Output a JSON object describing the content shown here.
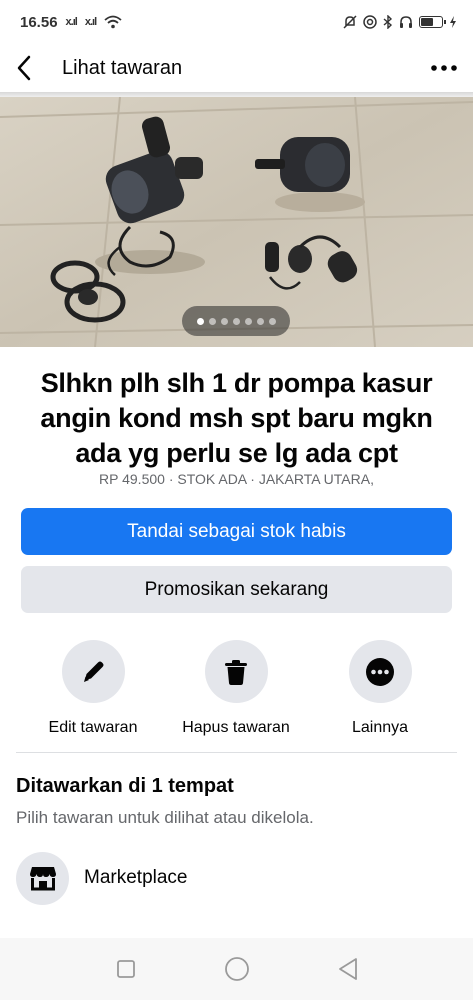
{
  "status_bar": {
    "time": "16.56",
    "signal_1": "x.ıl",
    "signal_2": "x.ıl",
    "icons": [
      "wifi-icon",
      "mute-icon",
      "at-icon",
      "bluetooth-icon",
      "headphones-icon",
      "battery-icon"
    ]
  },
  "header": {
    "title": "Lihat tawaran",
    "back_icon": "back-chevron-icon",
    "more_icon": "more-dots-icon"
  },
  "photo": {
    "page_count": 7,
    "active_index": 0
  },
  "listing": {
    "title_lines": [
      "Slhkn plh slh 1 dr pompa kasur",
      "angin kond msh spt baru mgkn",
      "ada yg perlu se lg ada cpt"
    ],
    "price": "RP 49.500",
    "stock": "STOK ADA",
    "location": "JAKARTA UTARA,",
    "separator": "·"
  },
  "buttons": {
    "mark_sold": "Tandai sebagai stok habis",
    "promote": "Promosikan sekarang"
  },
  "actions": [
    {
      "label": "Edit tawaran",
      "icon": "pencil-icon"
    },
    {
      "label": "Hapus tawaran",
      "icon": "trash-icon"
    },
    {
      "label": "Lainnya",
      "icon": "more-icon"
    }
  ],
  "offered": {
    "title": "Ditawarkan di 1 tempat",
    "subtitle": "Pilih tawaran untuk dilihat atau dikelola.",
    "place": "Marketplace",
    "place_icon": "marketplace-shop-icon"
  },
  "nav_bar": {
    "icons": [
      "recents-square-icon",
      "home-circle-icon",
      "back-triangle-icon"
    ]
  },
  "colors": {
    "accent": "#1877f2",
    "secondary_button": "#e4e6eb",
    "muted_text": "#65676b"
  }
}
